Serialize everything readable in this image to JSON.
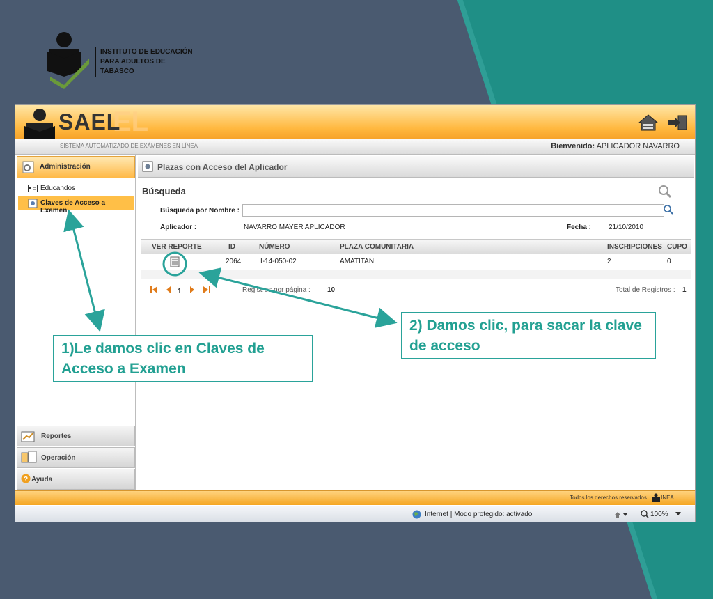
{
  "institution": {
    "lines": [
      "INSTITUTO DE EDUCACIÓN",
      "PARA ADULTOS DE",
      "TABASCO"
    ]
  },
  "app": {
    "title": "SAEL",
    "ghost": "EL",
    "subtitle": "SISTEMA AUTOMATIZADO DE EXÁMENES EN LÍNEA",
    "welcome_label": "Bienvenido:",
    "welcome_user": "APLICADOR NAVARRO"
  },
  "sidebar": {
    "section": "Administración",
    "items": [
      {
        "label": "Educandos"
      },
      {
        "label": "Claves de Acceso a Examen"
      }
    ],
    "accordions": [
      {
        "label": "Reportes"
      },
      {
        "label": "Operación"
      },
      {
        "label": "Ayuda"
      }
    ]
  },
  "main": {
    "panel_title": "Plazas con Acceso del Aplicador",
    "search_heading": "Búsqueda",
    "search_label": "Búsqueda por Nombre :",
    "search_value": "",
    "aplicador_label": "Aplicador :",
    "aplicador_value": "NAVARRO MAYER APLICADOR",
    "fecha_label": "Fecha :",
    "fecha_value": "21/10/2010",
    "columns": [
      "VER REPORTE",
      "ID",
      "NÚMERO",
      "PLAZA COMUNITARIA",
      "INSCRIPCIONES",
      "CUPO"
    ],
    "rows": [
      {
        "id": "2064",
        "numero": "I-14-050-02",
        "plaza": "AMATITAN",
        "inscripciones": "2",
        "cupo": "0"
      }
    ],
    "pager": {
      "page": "1",
      "per_page_label": "Registros por página :",
      "per_page_value": "10",
      "total_label": "Total de Registros :",
      "total_value": "1"
    }
  },
  "footer": {
    "text": "Todos los derechos reservados",
    "brand": "INEA."
  },
  "statusbar": {
    "zone": "Internet | Modo protegido: activado",
    "zoom": "100%"
  },
  "callouts": {
    "one": "1)Le damos clic en Claves de Acceso a Examen",
    "two": "2) Damos clic, para sacar la clave de acceso"
  },
  "colors": {
    "background": "#4a5a70",
    "teal": "#1f8f86",
    "accent_orange": "#ffb83f",
    "callout_teal": "#22a092"
  }
}
